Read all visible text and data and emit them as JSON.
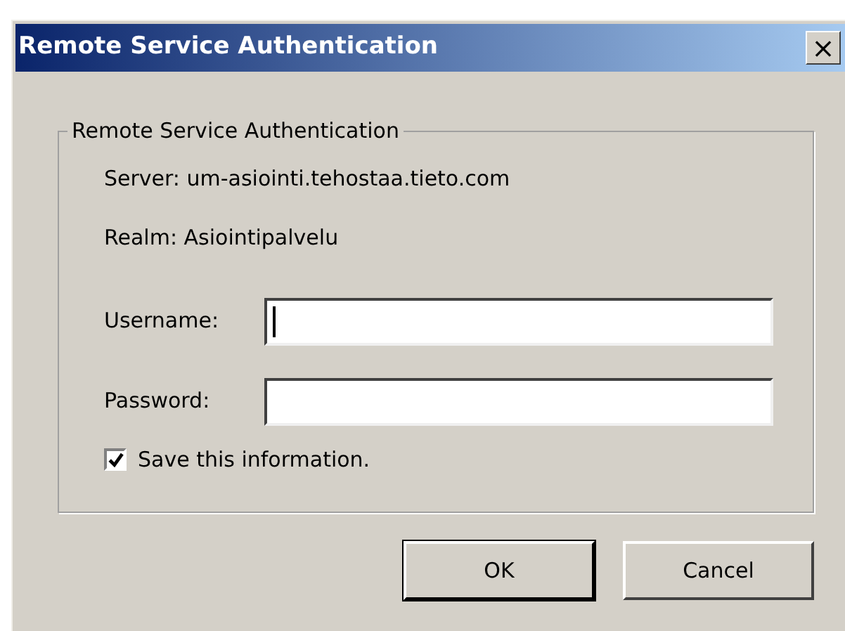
{
  "window": {
    "title": "Remote Service Authentication",
    "close": "×"
  },
  "group": {
    "title": "Remote Service Authentication",
    "info": [
      "Server: um-asiointi.tehostaa.tieto.com",
      "Realm: Asiointipalvelu"
    ],
    "fields": [
      {
        "label": "Username:",
        "focused": true
      },
      {
        "label": "Password:",
        "focused": false
      }
    ],
    "checkbox": {
      "label": "Save this information.",
      "checked": true
    }
  },
  "buttons": [
    {
      "label": "OK",
      "default": true
    },
    {
      "label": "Cancel",
      "default": false
    }
  ]
}
